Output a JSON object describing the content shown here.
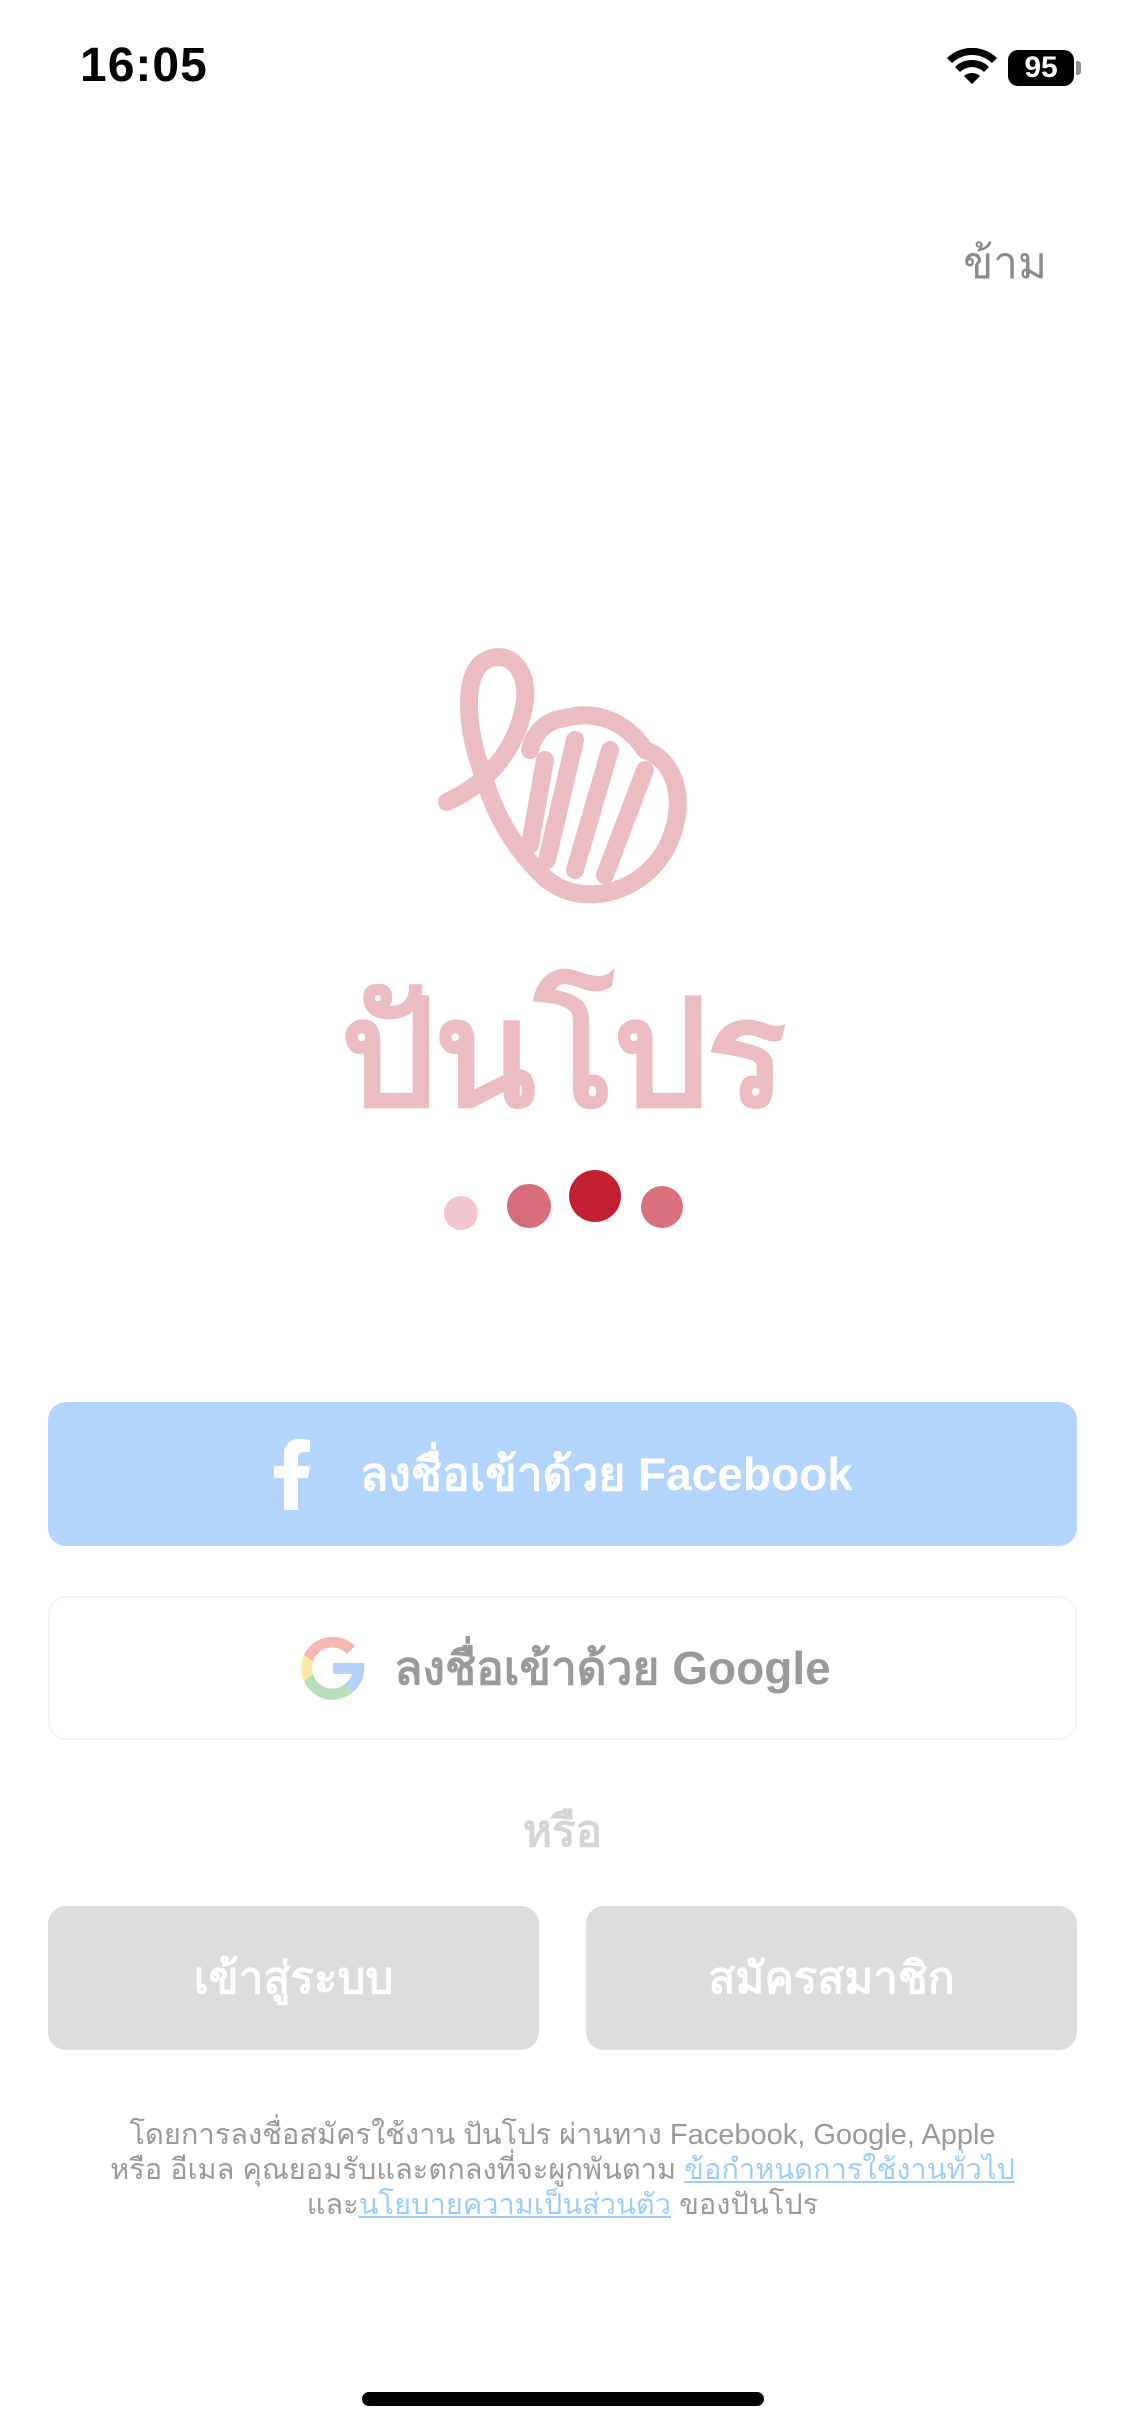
{
  "status_bar": {
    "time": "16:05",
    "battery": "95"
  },
  "skip_label": "ข้าม",
  "brand": {
    "name": "ปันโปร",
    "color": "#ecbcc3"
  },
  "pager": {
    "page_count": 4,
    "active_index": 2
  },
  "buttons": {
    "facebook_label": "ลงชื่อเข้าด้วย Facebook",
    "google_label": "ลงชื่อเข้าด้วย Google",
    "or_label": "หรือ",
    "login_label": "เข้าสู่ระบบ",
    "register_label": "สมัครสมาชิก"
  },
  "legal": {
    "line1": "โดยการลงชื่อสมัครใช้งาน ปันโปร ผ่านทาง Facebook, Google, Apple",
    "line2_prefix": "หรือ อีเมล คุณยอมรับและตกลงที่จะผูกพันตาม",
    "terms_link": "ข้อกำหนดการใช้งานทั่วไป",
    "line3_prefix": "และ",
    "privacy_link": "นโยบายความเป็นส่วนตัว",
    "line3_suffix": "ของปันโปร"
  },
  "colors": {
    "facebook_button": "#b3d5fb",
    "secondary_button": "#dcdcdc",
    "link": "#9ccdf6",
    "pager_active": "#c32033"
  }
}
